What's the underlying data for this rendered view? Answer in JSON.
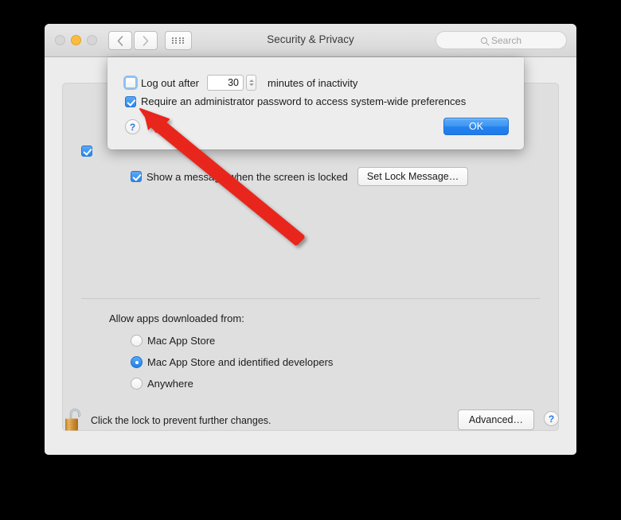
{
  "window": {
    "title": "Security & Privacy",
    "traffic_lights": [
      "close",
      "minimize",
      "zoom"
    ],
    "nav_back_icon": "chevron-left-icon",
    "nav_forward_icon": "chevron-right-icon",
    "grid_icon": "show-all-grid-icon"
  },
  "search": {
    "placeholder": "Search",
    "value": "",
    "icon": "search-icon"
  },
  "sheet": {
    "logout": {
      "label": "Log out after",
      "checked": false,
      "focused": true,
      "minutes_value": "30",
      "trailing_label": "minutes of inactivity",
      "stepper_icon": "stepper-updown-icon"
    },
    "require_admin": {
      "label": "Require an administrator password to access system-wide preferences",
      "checked": true
    },
    "help_label": "?",
    "ok_label": "OK"
  },
  "panel": {
    "lock_message": {
      "label": "Show a message when the screen is locked",
      "checked": true,
      "button_label": "Set Lock Message…"
    },
    "gatekeeper": {
      "heading": "Allow apps downloaded from:",
      "selected_index": 1,
      "options": [
        "Mac App Store",
        "Mac App Store and identified developers",
        "Anywhere"
      ]
    }
  },
  "bottom": {
    "lock_icon": "unlocked-padlock-icon",
    "lock_text": "Click the lock to prevent further changes.",
    "advanced_label": "Advanced…",
    "help_label": "?"
  },
  "annotation": {
    "arrow_color": "#e8251c",
    "arrow_name": "red-pointer-arrow"
  },
  "colors": {
    "accent_blue": "#2b87ee",
    "window_bg": "#ececec",
    "panel_bg": "#dfdfdf",
    "sheet_bg": "#ededed",
    "lock_gold": "#d79a39"
  }
}
